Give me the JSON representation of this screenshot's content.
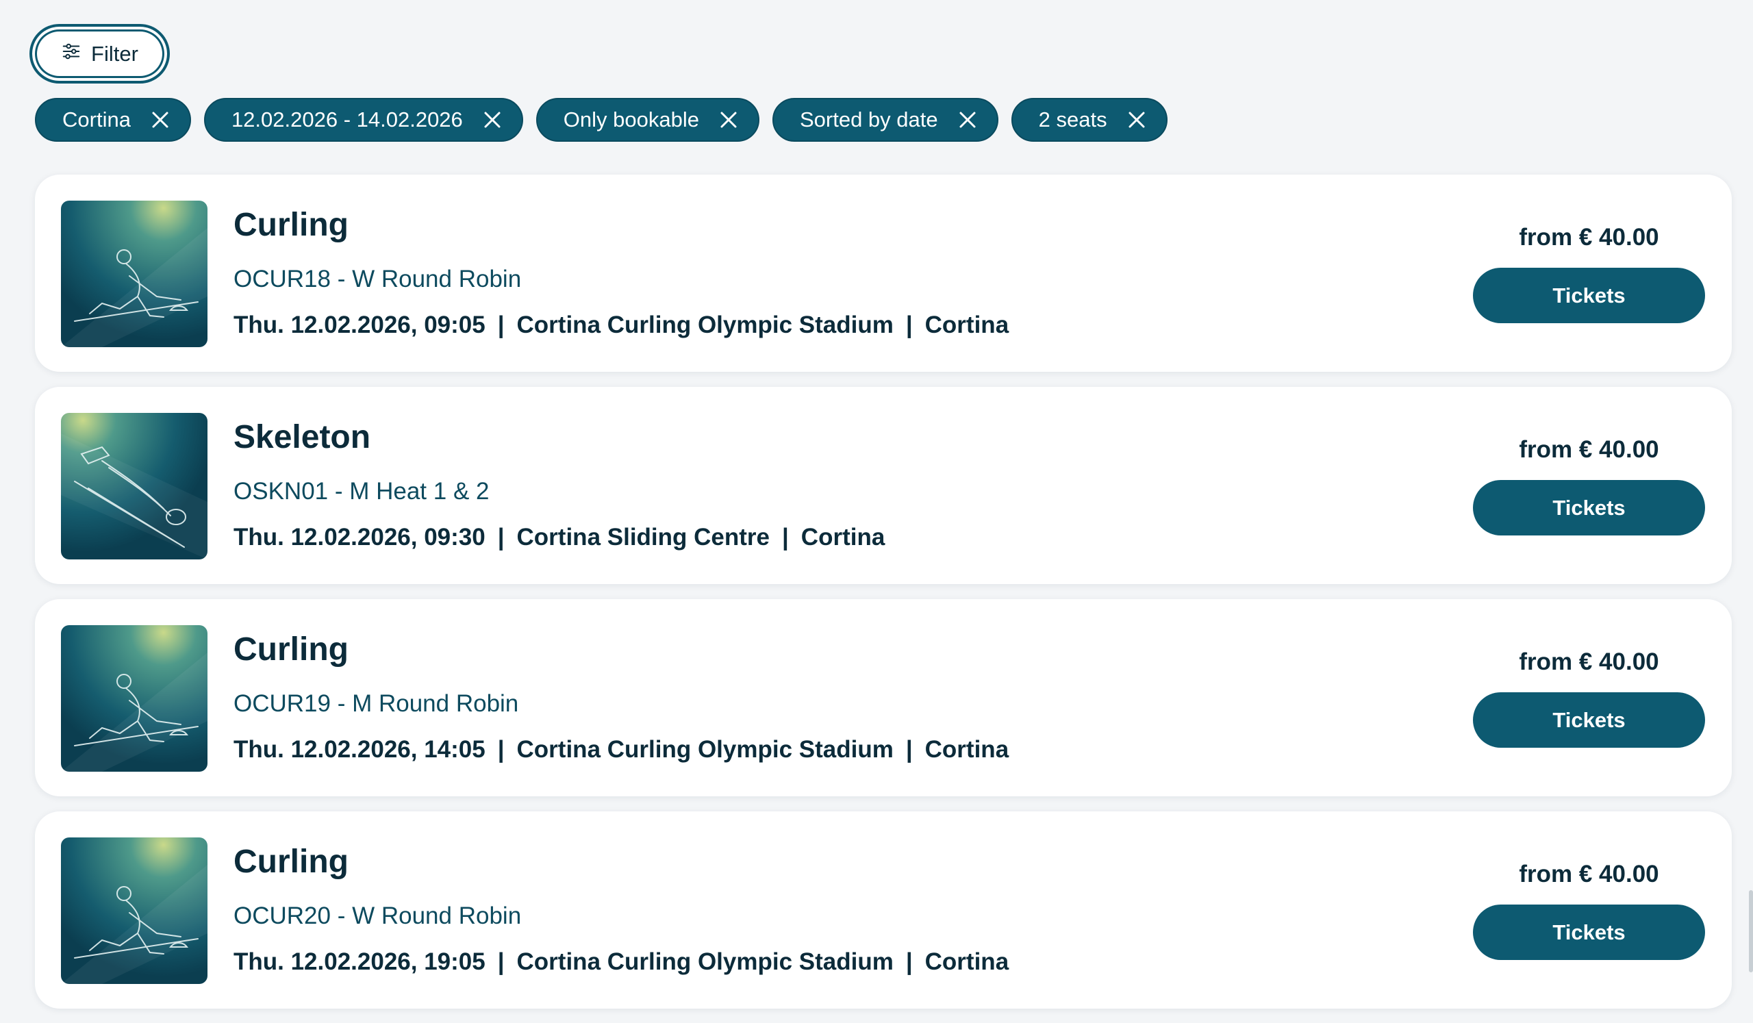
{
  "filter_button": {
    "label": "Filter",
    "icon": "sliders-icon"
  },
  "chips": [
    {
      "label": "Cortina"
    },
    {
      "label": "12.02.2026 - 14.02.2026"
    },
    {
      "label": "Only bookable"
    },
    {
      "label": "Sorted by date"
    },
    {
      "label": "2 seats"
    }
  ],
  "events": [
    {
      "sport": "Curling",
      "code": "OCUR18 - W Round Robin",
      "datetime": "Thu. 12.02.2026, 09:05",
      "sep": "|",
      "venue": "Cortina Curling Olympic Stadium",
      "city": "Cortina",
      "price": "from € 40.00",
      "button": "Tickets",
      "pictogram": "curling-pictogram"
    },
    {
      "sport": "Skeleton",
      "code": "OSKN01 - M Heat 1 & 2",
      "datetime": "Thu. 12.02.2026, 09:30",
      "sep": "|",
      "venue": "Cortina Sliding Centre",
      "city": "Cortina",
      "price": "from € 40.00",
      "button": "Tickets",
      "pictogram": "skeleton-pictogram"
    },
    {
      "sport": "Curling",
      "code": "OCUR19 - M Round Robin",
      "datetime": "Thu. 12.02.2026, 14:05",
      "sep": "|",
      "venue": "Cortina Curling Olympic Stadium",
      "city": "Cortina",
      "price": "from € 40.00",
      "button": "Tickets",
      "pictogram": "curling-pictogram"
    },
    {
      "sport": "Curling",
      "code": "OCUR20 - W Round Robin",
      "datetime": "Thu. 12.02.2026, 19:05",
      "sep": "|",
      "venue": "Cortina Curling Olympic Stadium",
      "city": "Cortina",
      "price": "from € 40.00",
      "button": "Tickets",
      "pictogram": "curling-pictogram"
    }
  ],
  "colors": {
    "accent": "#0d5a71",
    "text": "#0c2b3a",
    "background": "#f3f5f7",
    "card": "#ffffff"
  }
}
